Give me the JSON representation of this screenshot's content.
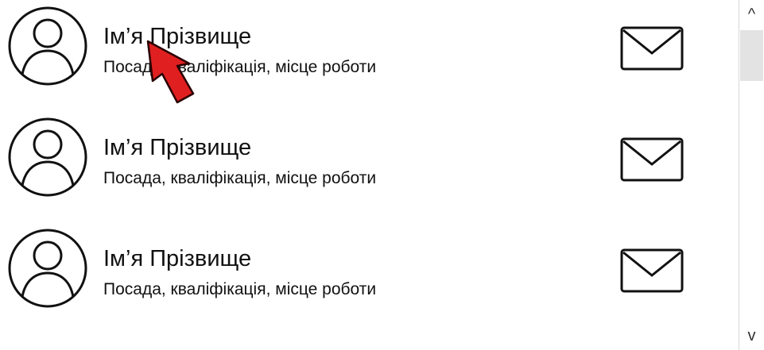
{
  "contacts": [
    {
      "name": "Ім’я Прізвище",
      "description": "Посада, кваліфікація, місце роботи",
      "avatar_icon": "user-avatar-icon",
      "action_icon": "envelope-icon"
    },
    {
      "name": "Ім’я Прізвище",
      "description": "Посада, кваліфікація, місце роботи",
      "avatar_icon": "user-avatar-icon",
      "action_icon": "envelope-icon"
    },
    {
      "name": "Ім’я Прізвище",
      "description": "Посада, кваліфікація, місце роботи",
      "avatar_icon": "user-avatar-icon",
      "action_icon": "envelope-icon"
    }
  ],
  "scrollbar": {
    "up_arrow": "^",
    "down_arrow": "v"
  },
  "cursor": {
    "icon": "red-arrow-cursor-icon",
    "color": "#e02020"
  }
}
